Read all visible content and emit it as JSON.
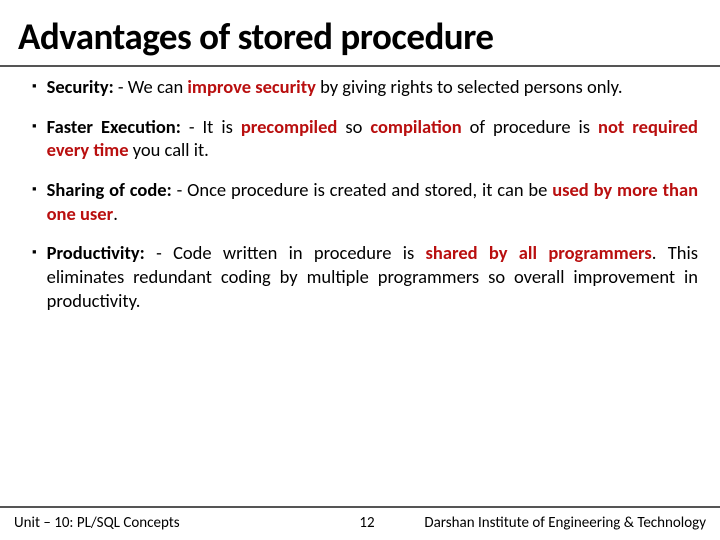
{
  "title": "Advantages of stored procedure",
  "bullets": [
    {
      "label": "Security:",
      "sep": " - ",
      "pre": "We can ",
      "hl": "improve security",
      "post": " by giving rights to selected persons only."
    },
    {
      "label": "Faster Execution:",
      "sep": " - ",
      "pre": "It is ",
      "hl": "precompiled",
      "mid1": " so ",
      "hl2": "compilation",
      "mid2": " of procedure is ",
      "hl3": "not required every time",
      "post": " you call it."
    },
    {
      "label": "Sharing of code:",
      "sep": " - ",
      "pre": "Once procedure is created and stored, it can be ",
      "hl": "used by more than one user",
      "post": "."
    },
    {
      "label": "Productivity:",
      "sep": " - ",
      "pre": "Code written in procedure is ",
      "hl": "shared by all programmers",
      "post": ". This eliminates redundant coding by multiple programmers so overall improvement in productivity."
    }
  ],
  "footer": {
    "left": "Unit – 10: PL/SQL Concepts",
    "page": "12",
    "right": "Darshan Institute of Engineering & Technology"
  }
}
